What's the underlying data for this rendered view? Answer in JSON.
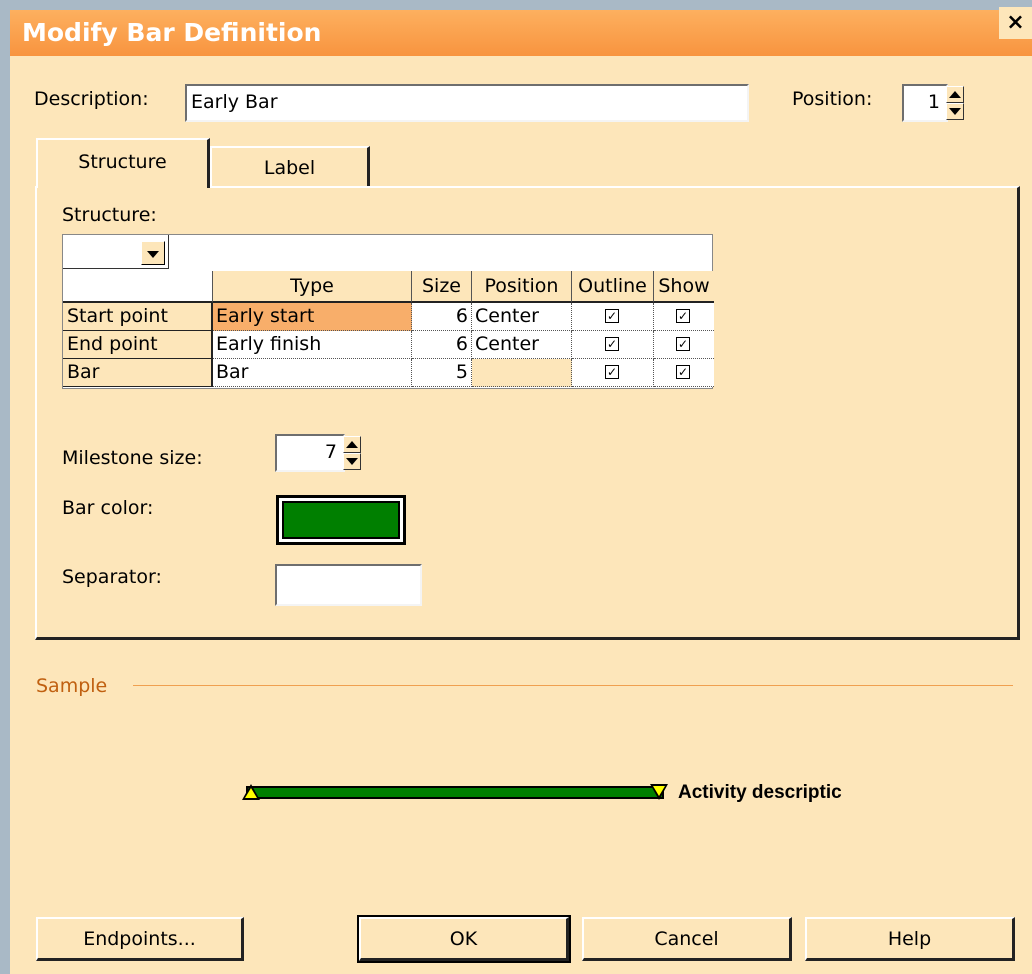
{
  "window": {
    "title": "Modify Bar Definition",
    "close_glyph": "×"
  },
  "description": {
    "label": "Description:",
    "value": "Early Bar"
  },
  "position": {
    "label": "Position:",
    "value": "1"
  },
  "tabs": [
    {
      "label": "Structure"
    },
    {
      "label": "Label"
    }
  ],
  "structure": {
    "label": "Structure:",
    "dropdown_value": "",
    "columns": [
      "Type",
      "Size",
      "Position",
      "Outline",
      "Show"
    ],
    "rows": [
      {
        "name": "Start point",
        "type": "Early start",
        "size": "6",
        "position": "Center",
        "outline": true,
        "show": true
      },
      {
        "name": "End point",
        "type": "Early finish",
        "size": "6",
        "position": "Center",
        "outline": true,
        "show": true
      },
      {
        "name": "Bar",
        "type": "Bar",
        "size": "5",
        "position": "",
        "outline": true,
        "show": true
      }
    ]
  },
  "milestone": {
    "label": "Milestone size:",
    "value": "7"
  },
  "bar_color": {
    "label": "Bar color:",
    "color": "#007f00"
  },
  "separator": {
    "label": "Separator:",
    "value": ""
  },
  "sample": {
    "label": "Sample",
    "bar_text": "Activity descriptic",
    "bar_color": "#007f00",
    "marker_color": "#ffff00"
  },
  "buttons": {
    "endpoints": "Endpoints...",
    "ok": "OK",
    "cancel": "Cancel",
    "help": "Help"
  },
  "colors": {
    "title_bar": "#f8943f",
    "dialog_bg": "#fde6ba",
    "highlight_cell": "#f8ae6a",
    "accent_line": "#f0a050"
  }
}
